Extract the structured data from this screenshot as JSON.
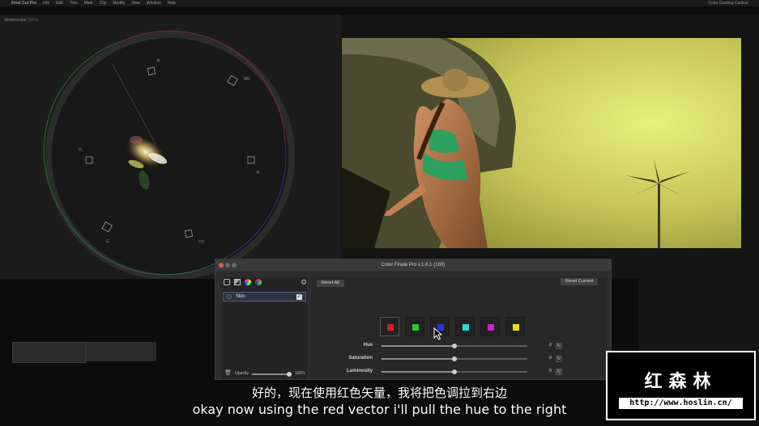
{
  "menubar": {
    "apple": "",
    "items": [
      "Final Cut Pro",
      "File",
      "Edit",
      "Trim",
      "Mark",
      "Clip",
      "Modify",
      "View",
      "Window",
      "Help"
    ],
    "right": "Color Grading Central"
  },
  "vectorscope": {
    "title": "Vectorscope",
    "subtitle": "100%",
    "targets": [
      "R",
      "MG",
      "B",
      "CY",
      "G",
      "YL"
    ]
  },
  "plugin": {
    "title": "Color Finale Pro v.1.6.1 (169)",
    "layer_name": "Skin",
    "opacity_label": "Opacity",
    "opacity_value": "100%",
    "opacity_level": 1.0,
    "reset_all": "Reset All",
    "reset_current": "Reset Current",
    "swatches": [
      "#d42020",
      "#22cc22",
      "#2233dd",
      "#22dddd",
      "#cc22cc",
      "#eedd11"
    ],
    "sliders": [
      {
        "label": "Hue",
        "value": "0",
        "level": 0.5
      },
      {
        "label": "Saturation",
        "value": "0",
        "level": 0.5
      },
      {
        "label": "Luminosity",
        "value": "0",
        "level": 0.5
      }
    ]
  },
  "subtitles": {
    "cn": "好的，现在使用红色矢量，我将把色调拉到右边",
    "en": "okay now using the red vector i'll pull the hue to the right"
  },
  "watermark": {
    "title": "红森林",
    "url": "http://www.hoslin.cn/"
  }
}
